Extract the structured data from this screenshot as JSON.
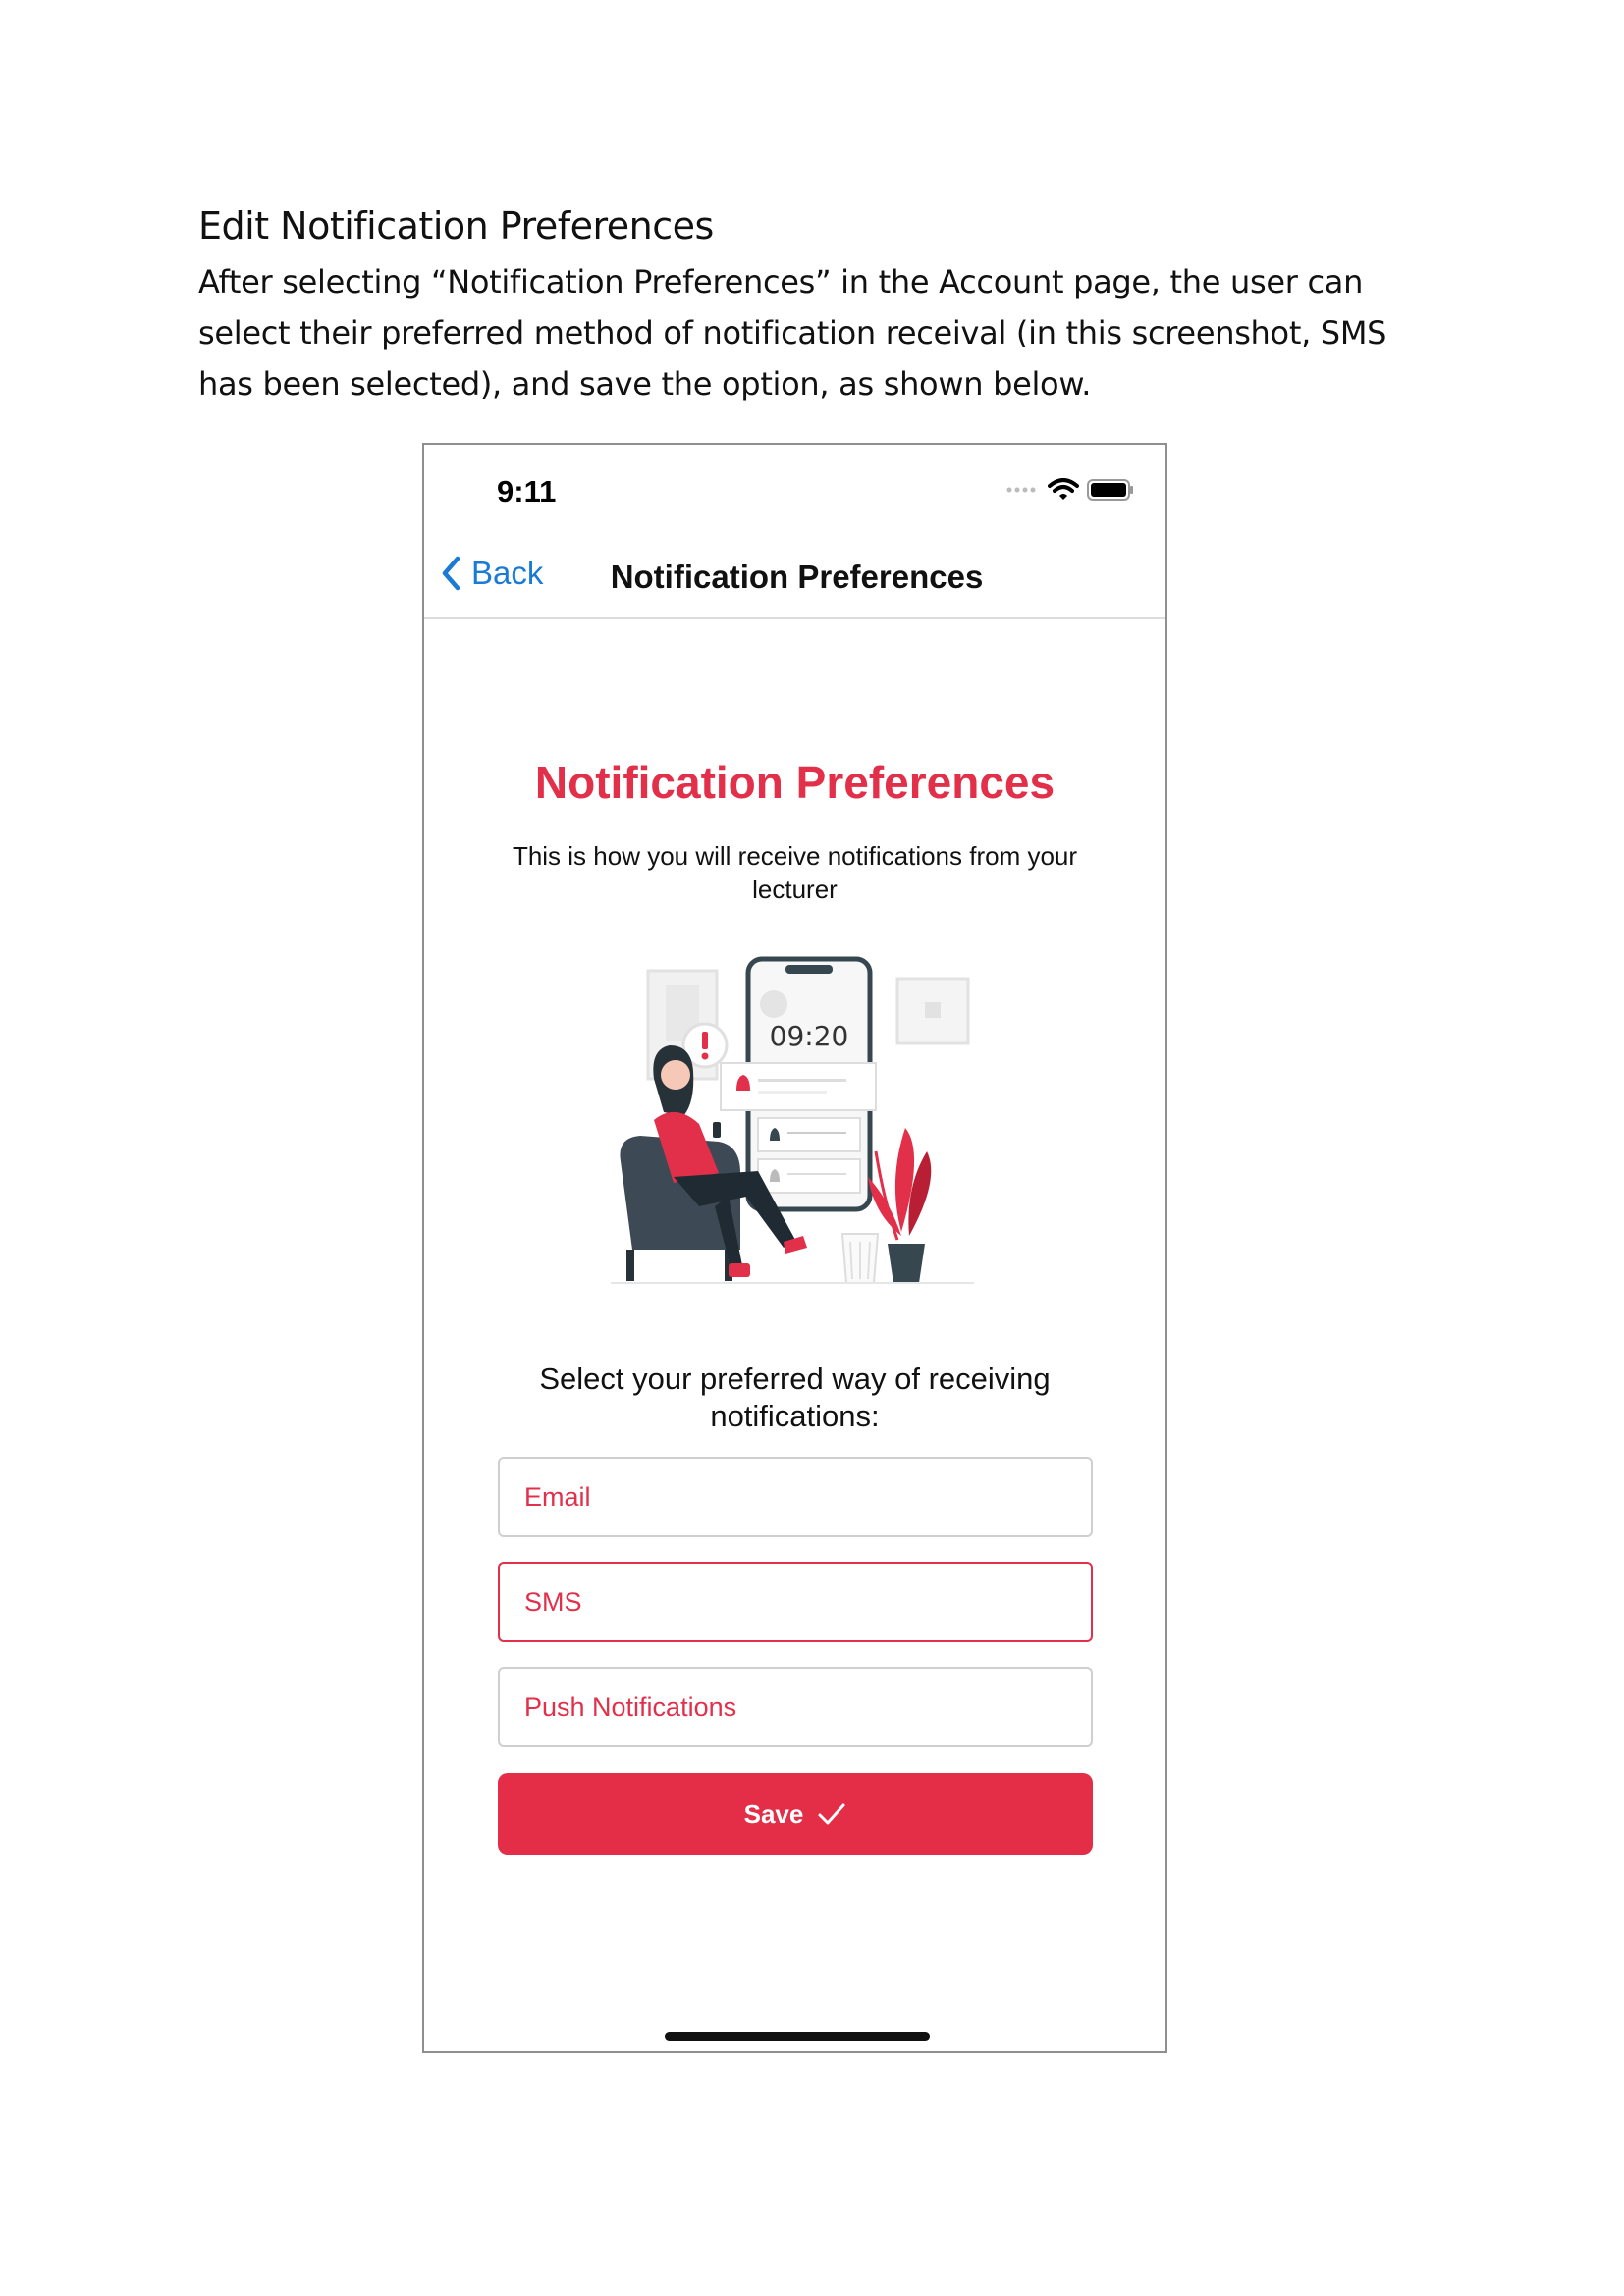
{
  "document": {
    "heading": "Edit Notification Preferences",
    "paragraph": "After selecting “Notification Preferences” in the Account page, the user can select their preferred method of notification receival (in this screenshot, SMS has been selected), and save the option, as shown below."
  },
  "status_bar": {
    "time": "9:11",
    "icons": [
      "signal-dots-icon",
      "wifi-icon",
      "battery-icon"
    ]
  },
  "nav": {
    "back_label": "Back",
    "title": "Notification Preferences"
  },
  "content": {
    "title": "Notification Preferences",
    "subtitle": "This is how you will receive notifications from your lecturer",
    "illustration_clock": "09:20",
    "select_label": "Select your preferred way of receiving notifications:",
    "options": [
      {
        "label": "Email",
        "selected": false
      },
      {
        "label": "SMS",
        "selected": true
      },
      {
        "label": "Push Notifications",
        "selected": false
      }
    ],
    "save_label": "Save"
  },
  "colors": {
    "accent": "#e2304a",
    "link": "#1a7bd6",
    "border": "#cfcfcf"
  }
}
